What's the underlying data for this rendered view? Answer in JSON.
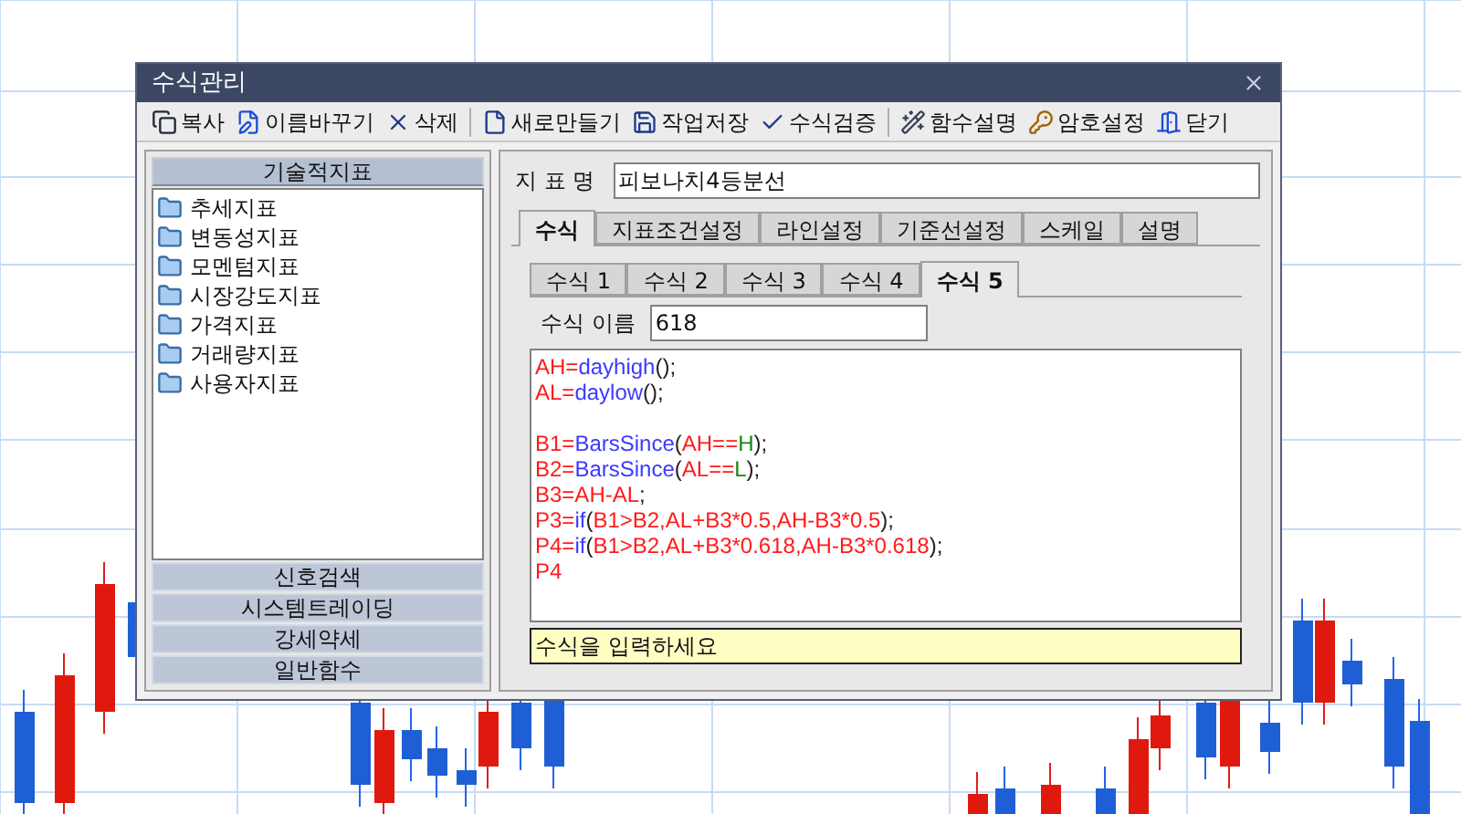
{
  "window": {
    "title": "수식관리"
  },
  "toolbar": [
    {
      "label": "복사",
      "kind": "copy"
    },
    {
      "label": "이름바꾸기",
      "kind": "rename"
    },
    {
      "label": "삭제",
      "kind": "delete"
    },
    {
      "label": "새로만들기",
      "kind": "new"
    },
    {
      "label": "작업저장",
      "kind": "save"
    },
    {
      "label": "수식검증",
      "kind": "verify"
    },
    {
      "label": "함수설명",
      "kind": "wand"
    },
    {
      "label": "암호설정",
      "kind": "key"
    },
    {
      "label": "닫기",
      "kind": "exit"
    }
  ],
  "sidebar": {
    "sections": [
      {
        "label": "기술적지표",
        "expanded": true,
        "items": [
          "추세지표",
          "변동성지표",
          "모멘텀지표",
          "시장강도지표",
          "가격지표",
          "거래량지표",
          "사용자지표"
        ]
      },
      {
        "label": "신호검색",
        "expanded": false
      },
      {
        "label": "시스템트레이딩",
        "expanded": false
      },
      {
        "label": "강세약세",
        "expanded": false
      },
      {
        "label": "일반함수",
        "expanded": false
      }
    ]
  },
  "indicator_name": {
    "label": "지 표 명",
    "value": "피보나치4등분선"
  },
  "tabs": [
    {
      "label": "수식",
      "selected": true
    },
    {
      "label": "지표조건설정",
      "selected": false
    },
    {
      "label": "라인설정",
      "selected": false
    },
    {
      "label": "기준선설정",
      "selected": false
    },
    {
      "label": "스케일",
      "selected": false
    },
    {
      "label": "설명",
      "selected": false
    }
  ],
  "formula_tabs": [
    {
      "label": "수식 1",
      "selected": false
    },
    {
      "label": "수식 2",
      "selected": false
    },
    {
      "label": "수식 3",
      "selected": false
    },
    {
      "label": "수식 4",
      "selected": false
    },
    {
      "label": "수식 5",
      "selected": true
    }
  ],
  "formula_name": {
    "label": "수식 이름",
    "value": "618"
  },
  "code_lines": [
    {
      "kind": "code",
      "tokens": [
        {
          "kind": "var",
          "text": "AH="
        },
        {
          "kind": "func",
          "text": "dayhigh"
        },
        {
          "kind": "punct",
          "text": "();"
        }
      ]
    },
    {
      "kind": "code",
      "tokens": [
        {
          "kind": "var",
          "text": "AL="
        },
        {
          "kind": "func",
          "text": "daylow"
        },
        {
          "kind": "punct",
          "text": "();"
        }
      ]
    },
    {
      "kind": "blank"
    },
    {
      "kind": "code",
      "tokens": [
        {
          "kind": "var",
          "text": "B1="
        },
        {
          "kind": "func",
          "text": "BarsSince"
        },
        {
          "kind": "punct",
          "text": "("
        },
        {
          "kind": "var",
          "text": "AH=="
        },
        {
          "kind": "price",
          "text": "H"
        },
        {
          "kind": "punct",
          "text": ");"
        }
      ]
    },
    {
      "kind": "code",
      "tokens": [
        {
          "kind": "var",
          "text": "B2="
        },
        {
          "kind": "func",
          "text": "BarsSince"
        },
        {
          "kind": "punct",
          "text": "("
        },
        {
          "kind": "var",
          "text": "AL=="
        },
        {
          "kind": "price",
          "text": "L"
        },
        {
          "kind": "punct",
          "text": ");"
        }
      ]
    },
    {
      "kind": "code",
      "tokens": [
        {
          "kind": "var",
          "text": "B3=AH-AL"
        },
        {
          "kind": "punct",
          "text": ";"
        }
      ]
    },
    {
      "kind": "code",
      "tokens": [
        {
          "kind": "var",
          "text": "P3="
        },
        {
          "kind": "func",
          "text": "if"
        },
        {
          "kind": "punct",
          "text": "("
        },
        {
          "kind": "var",
          "text": "B1>B2,AL+B3*0.5,AH-B3*0.5"
        },
        {
          "kind": "punct",
          "text": ");"
        }
      ]
    },
    {
      "kind": "code",
      "tokens": [
        {
          "kind": "var",
          "text": "P4="
        },
        {
          "kind": "func",
          "text": "if"
        },
        {
          "kind": "punct",
          "text": "("
        },
        {
          "kind": "var",
          "text": "B1>B2,AL+B3*0.618,AH-B3*0.618"
        },
        {
          "kind": "punct",
          "text": ");"
        }
      ]
    },
    {
      "kind": "code",
      "tokens": [
        {
          "kind": "var",
          "text": "P4"
        }
      ]
    }
  ],
  "hint": "수식을 입력하세요"
}
